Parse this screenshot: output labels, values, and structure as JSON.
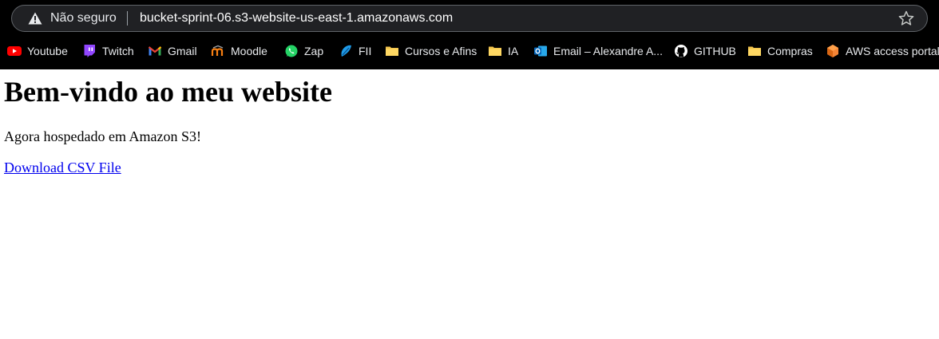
{
  "address_bar": {
    "security_label": "Não seguro",
    "url": "bucket-sprint-06.s3-website-us-east-1.amazonaws.com"
  },
  "bookmarks": [
    {
      "label": "Youtube",
      "icon": "youtube-icon"
    },
    {
      "label": "Twitch",
      "icon": "twitch-icon"
    },
    {
      "label": "Gmail",
      "icon": "gmail-icon"
    },
    {
      "label": "Moodle",
      "icon": "moodle-icon"
    },
    {
      "label": "Zap",
      "icon": "whatsapp-icon"
    },
    {
      "label": "FII",
      "icon": "fii-icon"
    },
    {
      "label": "Cursos e Afins",
      "icon": "folder-icon"
    },
    {
      "label": "IA",
      "icon": "folder-icon"
    },
    {
      "label": "Email – Alexandre A...",
      "icon": "outlook-icon"
    },
    {
      "label": "GITHUB",
      "icon": "github-icon"
    },
    {
      "label": "Compras",
      "icon": "folder-icon"
    },
    {
      "label": "AWS access portal",
      "icon": "aws-icon"
    }
  ],
  "page": {
    "heading": "Bem-vindo ao meu website",
    "subtitle": "Agora hospedado em Amazon S3!",
    "download_link": "Download CSV File"
  },
  "colors": {
    "toolbar_bg": "#000000",
    "link": "#0000ee"
  }
}
